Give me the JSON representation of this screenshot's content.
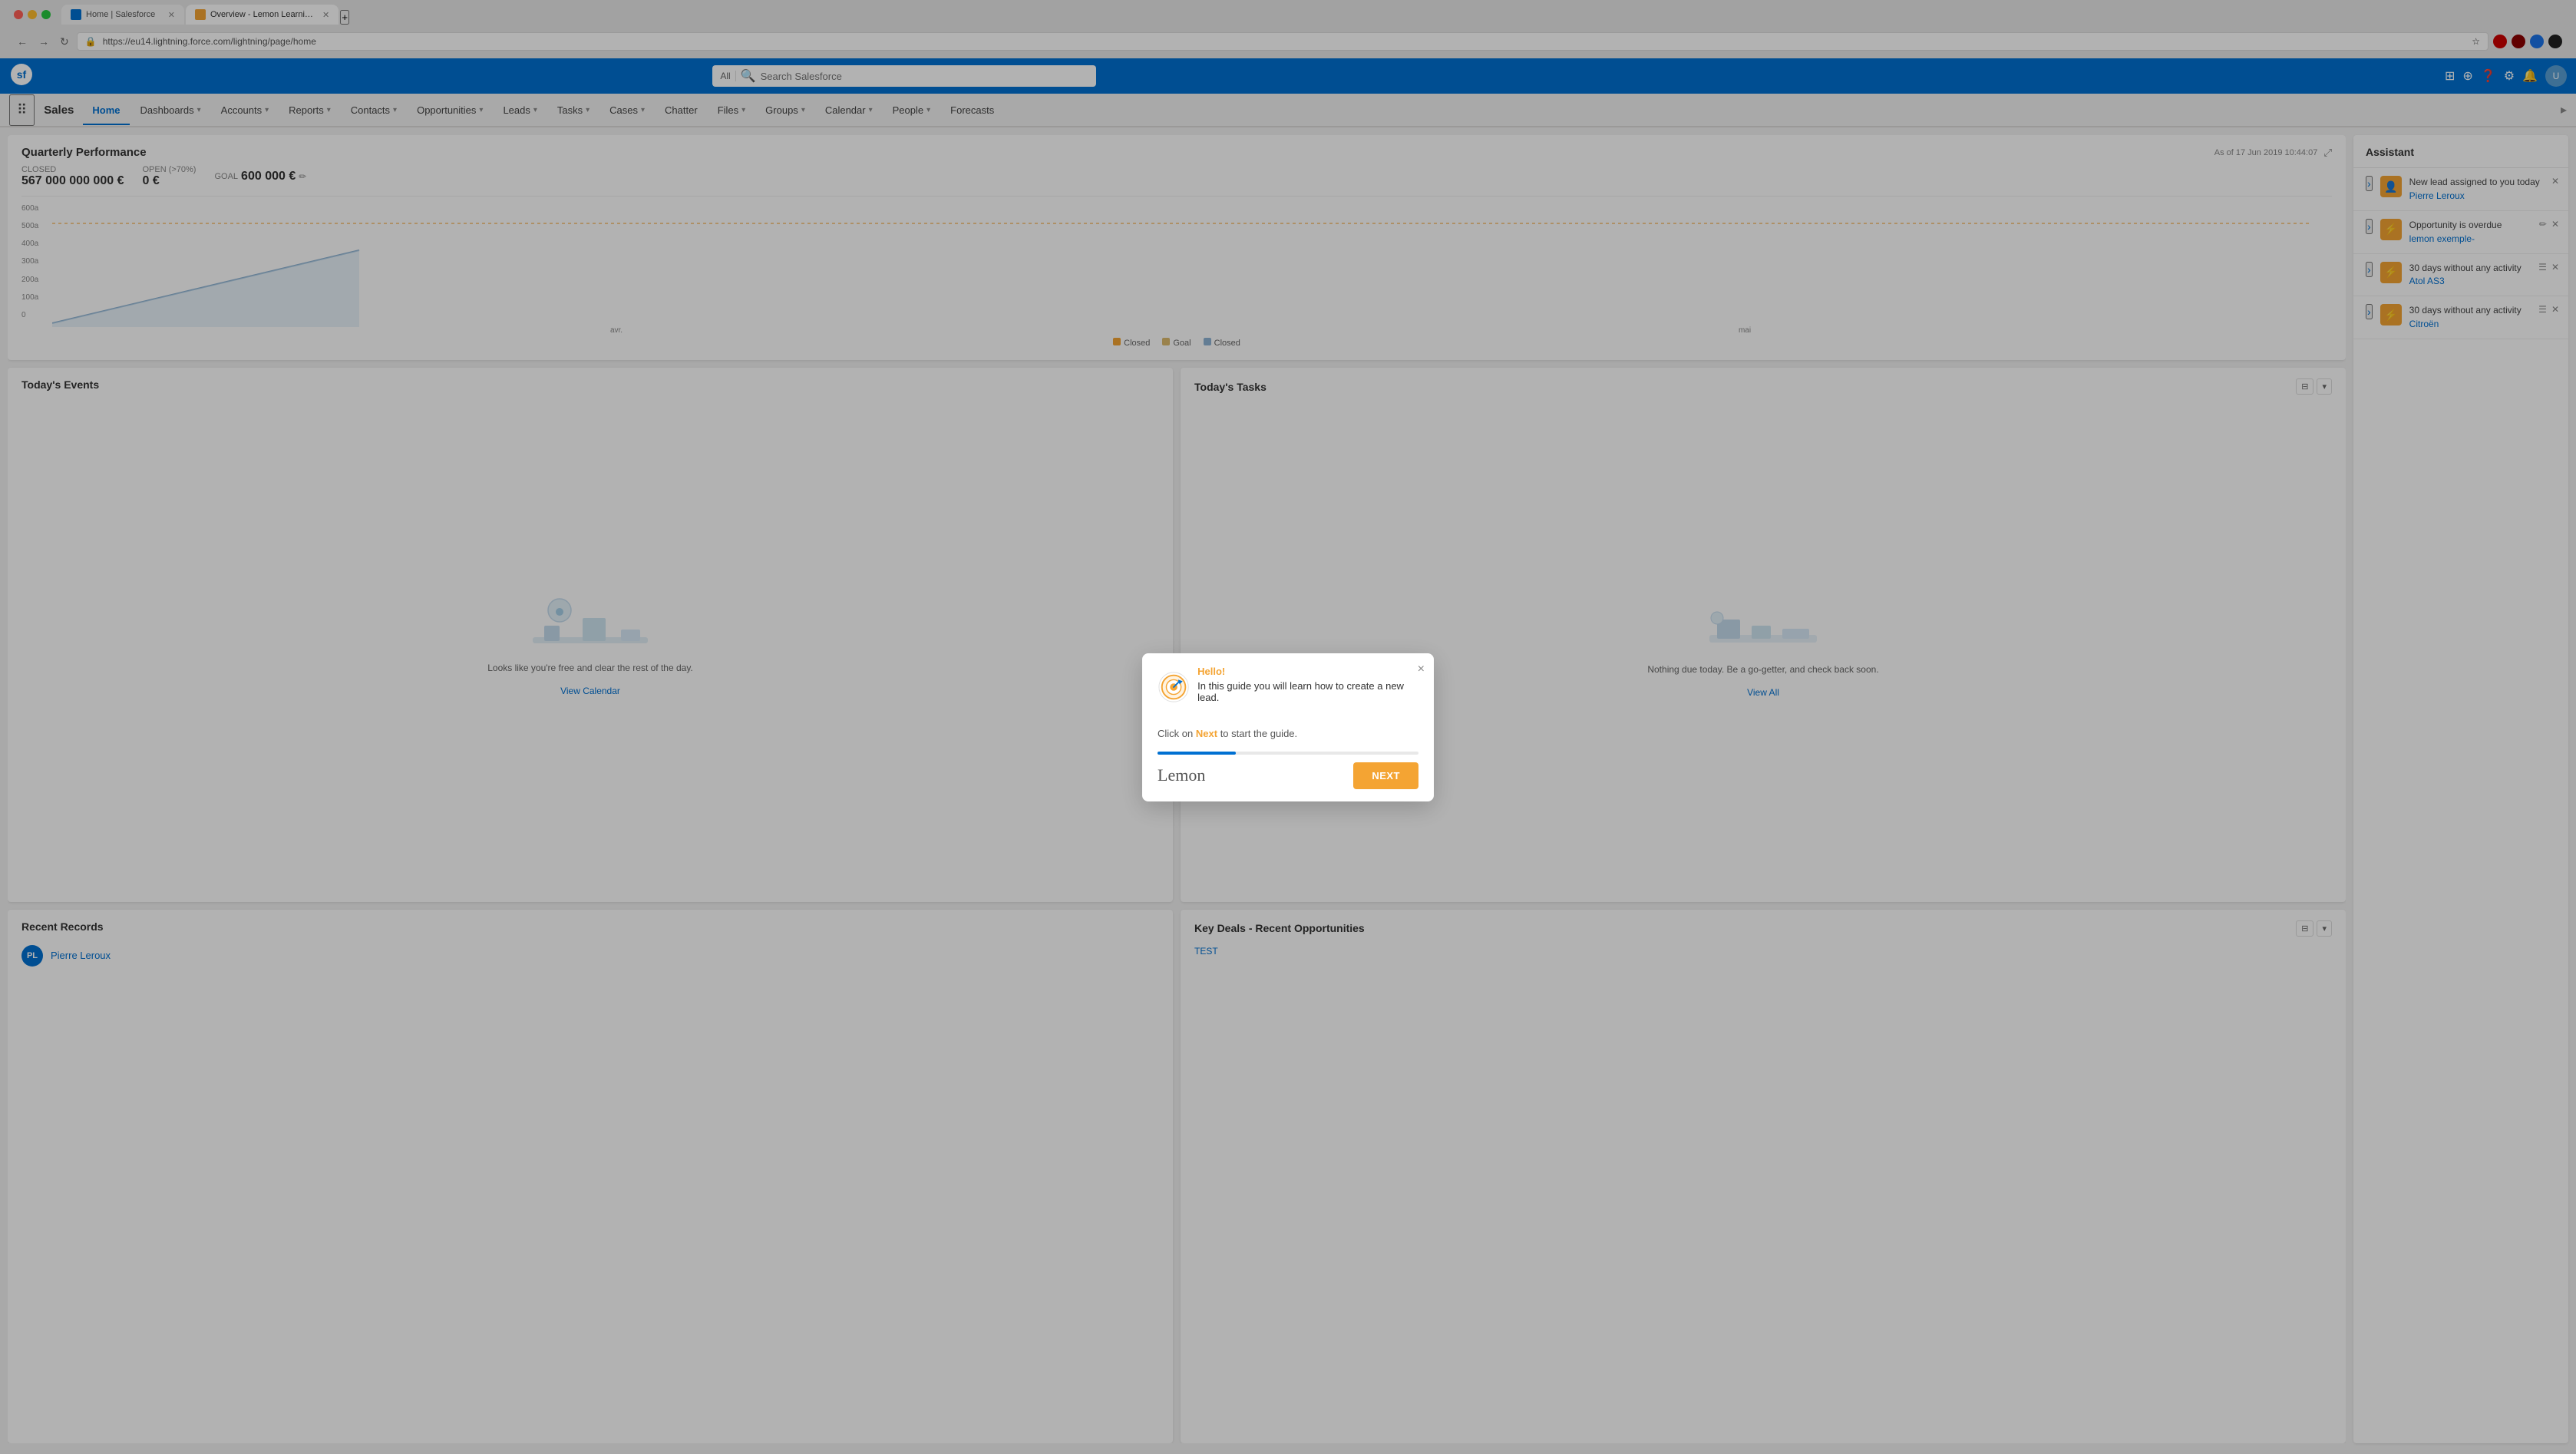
{
  "browser": {
    "url": "https://eu14.lightning.force.com/lightning/page/home",
    "tabs": [
      {
        "label": "Home | Salesforce",
        "active": false,
        "favicon": "sf"
      },
      {
        "label": "Overview - Lemon Learning Ad...",
        "active": true,
        "favicon": "lemon"
      }
    ]
  },
  "topbar": {
    "search_placeholder": "Search Salesforce",
    "search_filter": "All"
  },
  "navbar": {
    "app_name": "Sales",
    "items": [
      {
        "label": "Home",
        "active": true,
        "has_chevron": false
      },
      {
        "label": "Dashboards",
        "active": false,
        "has_chevron": true
      },
      {
        "label": "Accounts",
        "active": false,
        "has_chevron": true
      },
      {
        "label": "Reports",
        "active": false,
        "has_chevron": true
      },
      {
        "label": "Contacts",
        "active": false,
        "has_chevron": true
      },
      {
        "label": "Opportunities",
        "active": false,
        "has_chevron": true
      },
      {
        "label": "Leads",
        "active": false,
        "has_chevron": true
      },
      {
        "label": "Tasks",
        "active": false,
        "has_chevron": true
      },
      {
        "label": "Cases",
        "active": false,
        "has_chevron": true
      },
      {
        "label": "Chatter",
        "active": false,
        "has_chevron": false
      },
      {
        "label": "Files",
        "active": false,
        "has_chevron": true
      },
      {
        "label": "Groups",
        "active": false,
        "has_chevron": true
      },
      {
        "label": "Calendar",
        "active": false,
        "has_chevron": true
      },
      {
        "label": "People",
        "active": false,
        "has_chevron": true
      },
      {
        "label": "Forecasts",
        "active": false,
        "has_chevron": false
      }
    ]
  },
  "quarterly_performance": {
    "title": "Quarterly Performance",
    "as_of_label": "As of 17 Jun 2019 10:44:07",
    "closed_label": "CLOSED",
    "closed_value": "567 000 000 000 €",
    "open_label": "OPEN (>70%)",
    "open_value": "0 €",
    "goal_label": "GOAL",
    "goal_value": "600 000 €",
    "chart": {
      "y_labels": [
        "600a",
        "500a",
        "400a",
        "300a",
        "200a",
        "100a",
        "0"
      ],
      "x_labels": [
        "avr.",
        "mai"
      ],
      "legend": [
        {
          "label": "Closed",
          "color": "#f4a433"
        },
        {
          "label": "Goal",
          "color": "#ddbb6e"
        },
        {
          "label": "Closed",
          "color": "#8fb4d4"
        }
      ]
    }
  },
  "todays_events": {
    "title": "Today's Events",
    "empty_message": "Looks like you're free and clear the rest of the day.",
    "link_label": "View Calendar"
  },
  "todays_tasks": {
    "title": "Today's Tasks",
    "empty_message": "Nothing due today. Be a go-getter, and check back soon.",
    "link_label": "View All"
  },
  "recent_records": {
    "title": "Recent Records",
    "items": [
      {
        "name": "Pierre Leroux",
        "initials": "PL"
      }
    ]
  },
  "key_deals": {
    "title": "Key Deals - Recent Opportunities",
    "link_label": "TEST"
  },
  "assistant": {
    "title": "Assistant",
    "items": [
      {
        "label": "New lead assigned to you today",
        "link": "Pierre Leroux",
        "icon": "👤",
        "color": "orange"
      },
      {
        "label": "Opportunity is overdue",
        "link": "lemon exemple-",
        "icon": "⚡",
        "color": "orange"
      },
      {
        "label": "30 days without any activity",
        "link": "Atol AS3",
        "icon": "⚡",
        "color": "orange"
      },
      {
        "label": "30 days without any activity",
        "link": "Citroën",
        "icon": "⚡",
        "color": "orange"
      }
    ]
  },
  "modal": {
    "hello_label": "Hello!",
    "guide_text": "In this guide you will learn how to create a new lead.",
    "click_text": "Click on",
    "next_word": "Next",
    "after_next": "to start the guide.",
    "close_label": "×",
    "next_button": "NEXT",
    "brand_label": "Lemon",
    "progress_pct": 30
  }
}
